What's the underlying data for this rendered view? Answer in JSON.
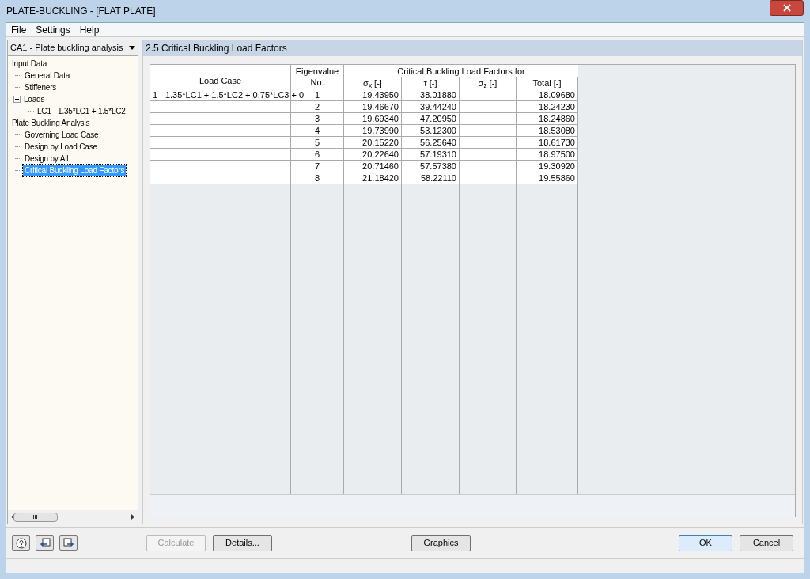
{
  "window": {
    "title": "PLATE-BUCKLING - [FLAT PLATE]"
  },
  "menu": [
    "File",
    "Settings",
    "Help"
  ],
  "case_select": {
    "value": "CA1 - Plate buckling analysis"
  },
  "tree": [
    {
      "label": "Input Data",
      "selected": false,
      "children": [
        {
          "label": "General Data",
          "selected": false
        },
        {
          "label": "Stiffeners",
          "selected": false
        },
        {
          "label": "Loads",
          "selected": false,
          "expanded": true,
          "children": [
            {
              "label": "LC1 - 1.35*LC1 + 1.5*LC2",
              "selected": false
            }
          ]
        }
      ]
    },
    {
      "label": "Plate Buckling Analysis",
      "selected": false,
      "children": [
        {
          "label": "Governing Load Case",
          "selected": false
        },
        {
          "label": "Design by Load Case",
          "selected": false
        },
        {
          "label": "Design by All",
          "selected": false
        },
        {
          "label": "Critical Buckling Load Factors",
          "selected": true
        }
      ]
    }
  ],
  "panel_title": "2.5 Critical Buckling Load Factors",
  "table": {
    "group_header": "Critical Buckling Load Factors for",
    "columns": [
      "Load Case",
      "Eigenvalue\nNo.",
      "σ$_{x}$ [-]",
      "τ [-]",
      "σ$_{z}$ [-]",
      "Total [-]"
    ],
    "rows": [
      [
        "1 - 1.35*LC1 + 1.5*LC2 + 0.75*LC3 + 0",
        "1",
        "19.43950",
        "38.01880",
        "",
        "18.09680"
      ],
      [
        "",
        "2",
        "19.46670",
        "39.44240",
        "",
        "18.24230"
      ],
      [
        "",
        "3",
        "19.69340",
        "47.20950",
        "",
        "18.24860"
      ],
      [
        "",
        "4",
        "19.73990",
        "53.12300",
        "",
        "18.53080"
      ],
      [
        "",
        "5",
        "20.15220",
        "56.25640",
        "",
        "18.61730"
      ],
      [
        "",
        "6",
        "20.22640",
        "57.19310",
        "",
        "18.97500"
      ],
      [
        "",
        "7",
        "20.71460",
        "57.57380",
        "",
        "19.30920"
      ],
      [
        "",
        "8",
        "21.18420",
        "58.22110",
        "",
        "19.55860"
      ]
    ]
  },
  "buttons": [
    {
      "label": "Calculate",
      "disabled": true
    },
    {
      "label": "Details...",
      "disabled": false
    }
  ],
  "graphics_button": "Graphics",
  "dialog_buttons": [
    {
      "label": "OK",
      "default": true
    },
    {
      "label": "Cancel",
      "default": false
    }
  ]
}
